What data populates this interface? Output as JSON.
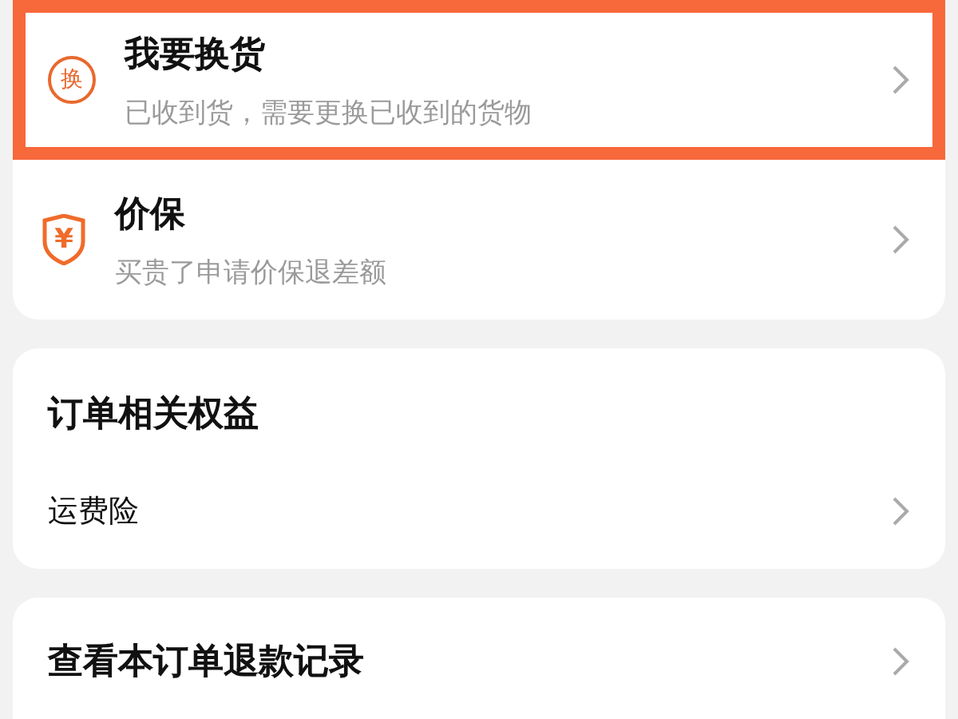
{
  "service_options": [
    {
      "kind": "circle",
      "icon_text": "换",
      "title": "我要换货",
      "subtitle": "已收到货，需要更换已收到的货物",
      "highlighted": true
    },
    {
      "kind": "shield",
      "icon_text": "¥",
      "title": "价保",
      "subtitle": "买贵了申请价保退差额",
      "highlighted": false
    }
  ],
  "order_benefits": {
    "title": "订单相关权益",
    "items": [
      {
        "label": "运费险"
      }
    ]
  },
  "refund_record": {
    "label": "查看本订单退款记录"
  }
}
